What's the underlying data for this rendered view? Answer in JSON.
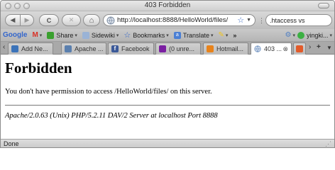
{
  "window": {
    "title": "403 Forbidden"
  },
  "toolbar": {
    "back_glyph": "◀",
    "forward_glyph": "▶",
    "reload_glyph": "C",
    "stop_glyph": "✕",
    "home_glyph": "⌂",
    "url": "http://localhost:8888/HelloWorld/files/",
    "search_value": ".htaccess vs"
  },
  "bookmarks": {
    "google_label": "Google",
    "gmail_label": "M",
    "share_label": "Share",
    "sidewiki_label": "Sidewiki",
    "bookmarks_label": "Bookmarks",
    "translate_label": "Translate",
    "overflow_label": "»",
    "user_label": "yingki..."
  },
  "tabs": [
    {
      "label": "Add Ne...",
      "icon": "page-icon",
      "color": "#3b73b9"
    },
    {
      "label": "Apache ...",
      "icon": "page-icon",
      "color": "#5a7fae"
    },
    {
      "label": "Facebook",
      "icon": "facebook-icon",
      "color": "#3b5998"
    },
    {
      "label": "(0 unre...",
      "icon": "yahoo-icon",
      "color": "#7b1fa2"
    },
    {
      "label": "Hotmail...",
      "icon": "hotmail-icon",
      "color": "#e8831b"
    },
    {
      "label": "403 ...",
      "icon": "globe-icon",
      "color": "#6a8fbf",
      "active": true
    }
  ],
  "page": {
    "heading": "Forbidden",
    "message": "You don't have permission to access /HelloWorld/files/ on this server.",
    "server_signature": "Apache/2.0.63 (Unix) PHP/5.2.11 DAV/2 Server at localhost Port 8888"
  },
  "status": {
    "text": "Done"
  }
}
